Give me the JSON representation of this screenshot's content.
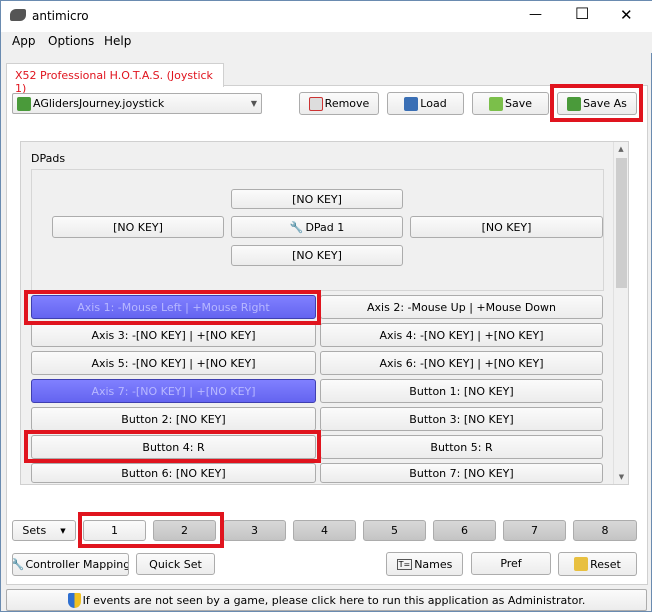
{
  "window": {
    "title": "antimicro",
    "minimize": "—",
    "maximize": "☐",
    "close": "✕"
  },
  "menu": [
    "App",
    "Options",
    "Help"
  ],
  "tab": "X52 Professional H.O.T.A.S. (Joystick 1)",
  "profile": "AGlidersJourney.joystick",
  "toolbar": {
    "remove": "Remove",
    "load": "Load",
    "save": "Save",
    "save_as": "Save As"
  },
  "dpads": {
    "label": "DPads",
    "up": "[NO KEY]",
    "left": "[NO KEY]",
    "center": "DPad 1",
    "right": "[NO KEY]",
    "down": "[NO KEY]"
  },
  "grid": [
    [
      "Axis 1: -Mouse Left | +Mouse Right",
      "Axis 2: -Mouse Up | +Mouse Down"
    ],
    [
      "Axis 3: -[NO KEY] | +[NO KEY]",
      "Axis 4: -[NO KEY] | +[NO KEY]"
    ],
    [
      "Axis 5: -[NO KEY] | +[NO KEY]",
      "Axis 6: -[NO KEY] | +[NO KEY]"
    ],
    [
      "Axis 7: -[NO KEY] | +[NO KEY]",
      "Button 1: [NO KEY]"
    ],
    [
      "Button 2: [NO KEY]",
      "Button 3: [NO KEY]"
    ],
    [
      "Button 4: R",
      "Button 5: R"
    ],
    [
      "Button 6: [NO KEY]",
      "Button 7: [NO KEY]"
    ]
  ],
  "sets": {
    "label": "Sets",
    "items": [
      "1",
      "2",
      "3",
      "4",
      "5",
      "6",
      "7",
      "8"
    ]
  },
  "bottom": {
    "mapping": "Controller Mapping",
    "quickset": "Quick Set",
    "names": "Names",
    "pref": "Pref",
    "reset": "Reset"
  },
  "status": "If events are not seen by a game, please click here to run this application as Administrator.",
  "colors": {
    "highlight": "#6c6cf4",
    "annotation": "#e0141e",
    "tab_text": "#e0141e"
  }
}
